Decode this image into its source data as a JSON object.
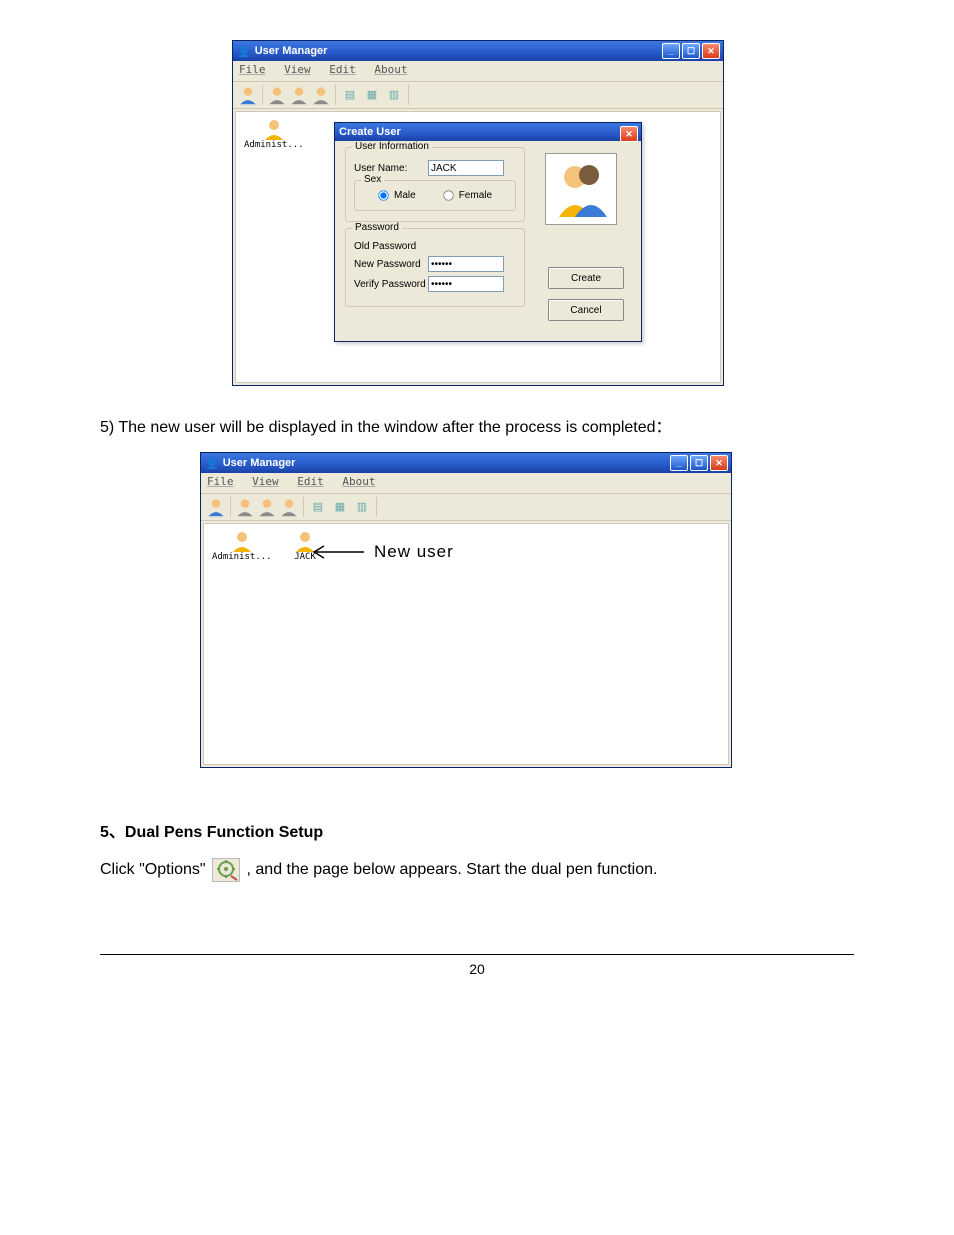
{
  "win1": {
    "title": "User Manager",
    "menus": [
      "File",
      "View",
      "Edit",
      "About"
    ],
    "users": [
      {
        "label": "Administ..."
      }
    ],
    "dialog": {
      "title": "Create User",
      "group_userinfo": "User Information",
      "lbl_username": "User Name:",
      "val_username": "JACK",
      "group_sex": "Sex",
      "lbl_male": "Male",
      "lbl_female": "Female",
      "group_password": "Password",
      "lbl_oldpw": "Old Password",
      "lbl_newpw": "New Password",
      "val_newpw": "******",
      "lbl_verifypw": "Verify Password",
      "val_verifypw": "******",
      "btn_create": "Create",
      "btn_cancel": "Cancel"
    }
  },
  "para_step5": "5) The new user will be displayed in the window after the process is completed：",
  "win2": {
    "title": "User Manager",
    "menus": [
      "File",
      "View",
      "Edit",
      "About"
    ],
    "users": [
      {
        "label": "Administ..."
      },
      {
        "label": "JACK"
      }
    ],
    "annotation": "New user"
  },
  "heading": "5、Dual Pens Function Setup",
  "para_options_pre": "Click \"Options\"",
  "para_options_post": " , and the page below appears.  Start the dual pen function.",
  "page_number": "20"
}
